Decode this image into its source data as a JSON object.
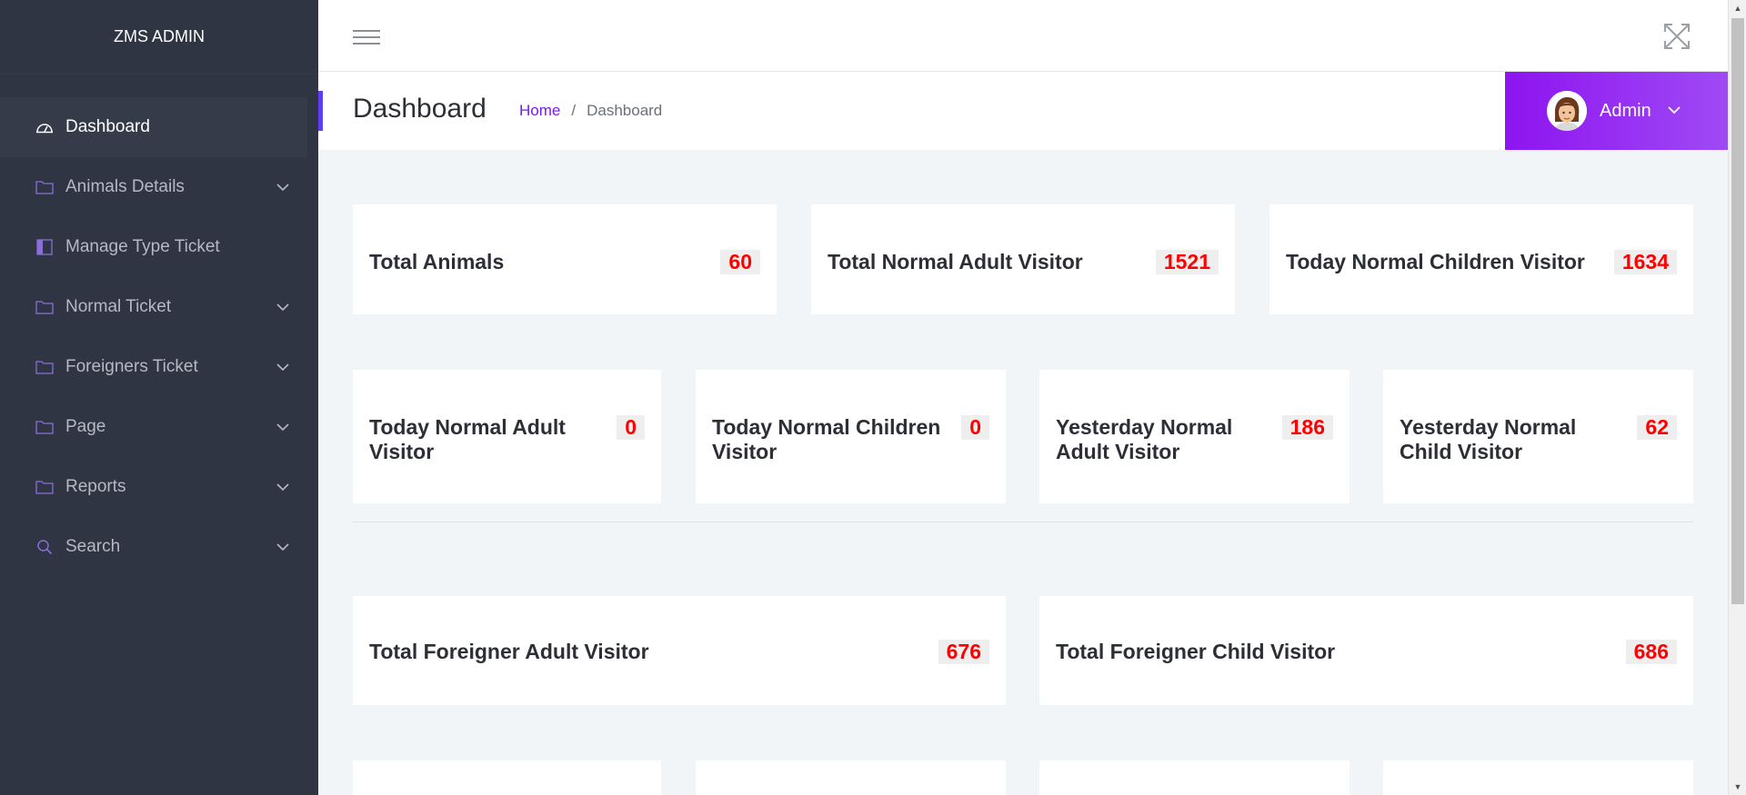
{
  "brand": "ZMS ADMIN",
  "sidebar": {
    "items": [
      {
        "label": "Dashboard",
        "icon": "dashboard-gauge-icon",
        "active": true
      },
      {
        "label": "Animals Details",
        "icon": "folder-icon",
        "has_submenu": true
      },
      {
        "label": "Manage Type Ticket",
        "icon": "layout-icon"
      },
      {
        "label": "Normal Ticket",
        "icon": "folder-icon",
        "has_submenu": true
      },
      {
        "label": "Foreigners Ticket",
        "icon": "folder-icon",
        "has_submenu": true
      },
      {
        "label": "Page",
        "icon": "folder-icon",
        "has_submenu": true
      },
      {
        "label": "Reports",
        "icon": "folder-icon",
        "has_submenu": true
      },
      {
        "label": "Search",
        "icon": "search-icon",
        "has_submenu": true
      }
    ]
  },
  "header": {
    "title": "Dashboard",
    "breadcrumb": {
      "home": "Home",
      "separator": "/",
      "current": "Dashboard"
    },
    "user": {
      "name": "Admin"
    }
  },
  "stats": {
    "row1": [
      {
        "label": "Total Animals",
        "value": "60"
      },
      {
        "label": "Total Normal Adult Visitor",
        "value": "1521"
      },
      {
        "label": "Today Normal Children Visitor",
        "value": "1634"
      }
    ],
    "row2": [
      {
        "label": "Today Normal Adult Visitor",
        "value": "0"
      },
      {
        "label": "Today Normal Children Visitor",
        "value": "0"
      },
      {
        "label": "Yesterday Normal Adult Visitor",
        "value": "186"
      },
      {
        "label": "Yesterday Normal Child Visitor",
        "value": "62"
      }
    ],
    "row3": [
      {
        "label": "Total Foreigner Adult Visitor",
        "value": "676"
      },
      {
        "label": "Total Foreigner Child Visitor",
        "value": "686"
      }
    ]
  },
  "colors": {
    "sidebar_bg": "#2f3542",
    "accent_purple": "#8e14f0",
    "stat_value": "#ff0000",
    "breadcrumb_link": "#7a18f0"
  }
}
